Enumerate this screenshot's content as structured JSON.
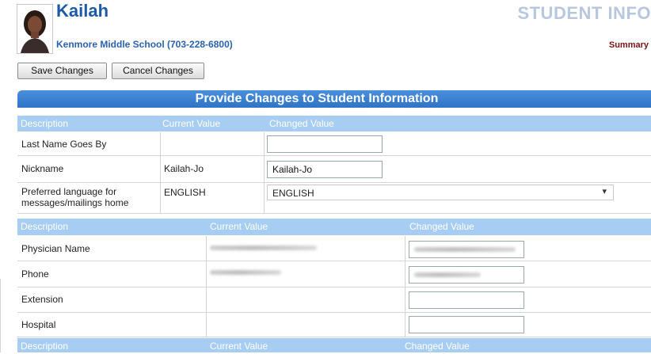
{
  "student": {
    "name": "Kailah",
    "school": "Kenmore Middle School (703-228-6800)"
  },
  "page": {
    "title": "STUDENT INFO",
    "summary_link": "Summary"
  },
  "toolbar": {
    "save_label": "Save Changes",
    "cancel_label": "Cancel Changes"
  },
  "panel": {
    "title": "Provide Changes to Student Information"
  },
  "section1": {
    "headers": {
      "description": "Description",
      "current": "Current Value",
      "changed": "Changed Value"
    },
    "rows": [
      {
        "label": "Last Name Goes By",
        "current": "",
        "changed": ""
      },
      {
        "label": "Nickname",
        "current": "Kailah-Jo",
        "changed": "Kailah-Jo"
      },
      {
        "label": "Preferred language for messages/mailings home",
        "current": "ENGLISH",
        "changed": "ENGLISH"
      }
    ]
  },
  "section2": {
    "headers": {
      "description": "Description",
      "current": "Current Value",
      "changed": "Changed Value"
    },
    "rows": [
      {
        "label": "Physician Name",
        "current": "",
        "changed": ""
      },
      {
        "label": "Phone",
        "current": "",
        "changed": ""
      },
      {
        "label": "Extension",
        "current": "",
        "changed": ""
      },
      {
        "label": "Hospital",
        "current": "",
        "changed": ""
      }
    ]
  },
  "section3": {
    "headers": {
      "description": "Description",
      "current": "Current Value",
      "changed": "Changed Value"
    }
  },
  "colors": {
    "accent": "#2f74c6",
    "header_bg": "#a7cdf2",
    "title_muted": "#b7c7de",
    "summary": "#7d1212"
  },
  "icons": {
    "language_dropdown": "chevron-down-icon"
  }
}
